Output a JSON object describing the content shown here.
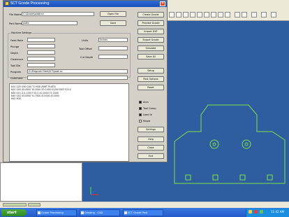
{
  "window": {
    "title": "SCT Gcode Processing"
  },
  "top_fields": {
    "file_name_label": "File Name",
    "file_name_value": "C:\\Gcode\\plate.nc",
    "part_name_label": "Part Name",
    "part_name_value": "plate",
    "open_button": "Open File",
    "save_button": "Save"
  },
  "options_group": {
    "title": "Machine Settings",
    "rows": [
      {
        "label": "Feed Rate",
        "value": ""
      },
      {
        "label": "Plunge",
        "value": ""
      },
      {
        "label": "Depth",
        "value": ""
      },
      {
        "label": "Clearance",
        "value": ""
      },
      {
        "label": "Tool Dia",
        "value": ""
      }
    ],
    "program_label": "Program",
    "program_value": "C:\\Program Files\\SCT\\post.nc",
    "comment_label": "Comment",
    "comment_value": "",
    "units_label": "Units",
    "units_value": "Inches",
    "tool_label": "Tool Offset",
    "tool_value": "",
    "cut_label": "Cut Depth",
    "cut_value": ""
  },
  "right_buttons": [
    "Create Gcode",
    "Preview Gcode",
    "Import DXF",
    "Export Gcode",
    "Simulate",
    "Save All",
    "Setup",
    "Post Options",
    "Reset"
  ],
  "right_checks": [
    {
      "label": "Arcs",
      "checked": true
    },
    {
      "label": "Tool Comp",
      "checked": true
    },
    {
      "label": "Lead In",
      "checked": true
    },
    {
      "label": "Rapid",
      "checked": false
    }
  ],
  "bottom_buttons": [
    "Settings",
    "Help",
    "Close",
    "Exit"
  ],
  "output_lines": [
    "N10 G20 G90 G40 T1 M06 (PART PLATE) ",
    "N20 G00 X0.0000 Y0.0000 Z0.1000 S1200 M03 F20.0 ",
    "N30 G01 Z-0.1250 F10.0 X2.5000 Y1.2500 ",
    "N40 G02 X3.0000 Y1.7500 I0.5000 J0.0000 ",
    "N50 M30 "
  ],
  "taskbar": {
    "start_label": "start",
    "tasks": [
      "Gcode Processing",
      "Drawing - CAD",
      "SCT Gcode Post"
    ],
    "clock": "11:42 AM"
  },
  "colors": {
    "viewport_bg": "#2f5ea0",
    "drawing_stroke": "#7fe04a",
    "titlebar": "#1f55c4"
  },
  "icons": [
    "cad-toolbar-icons",
    "axis-triad-icon",
    "window-icon",
    "close-icon"
  ]
}
